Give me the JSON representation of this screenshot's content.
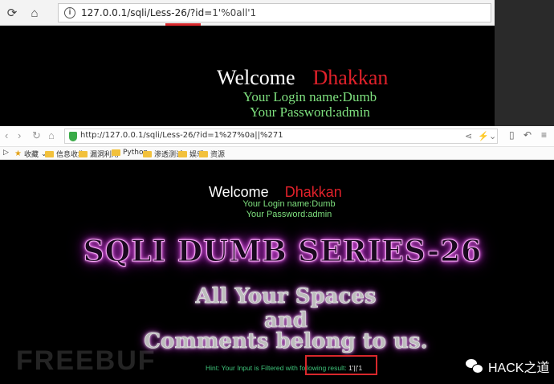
{
  "top_browser": {
    "url_prefix": "127.0.0.1/sqli/Less-26/?id=",
    "url_param": "1'%0all'1",
    "back_icon": "refresh-icon",
    "home_icon": "home-icon"
  },
  "top_page": {
    "welcome": "Welcome",
    "user": "Dhakkan",
    "login_name": "Your Login name:Dumb",
    "password": "Your Password:admin"
  },
  "second_browser": {
    "url": "http://127.0.0.1/sqli/Less-26/?id=1%27%0a||%271",
    "bookmarks": [
      "收藏",
      "信息收集",
      "漏洞利用",
      "Python",
      "渗透测试",
      "娱乐",
      "资源"
    ]
  },
  "second_page": {
    "welcome": "Welcome",
    "user": "Dhakkan",
    "login_name": "Your Login name:Dumb",
    "password": "Your Password:admin",
    "series_title": "SQLI DUMB SERIES-26",
    "line1": "All Your Spaces",
    "line2": "and",
    "line3": "Comments belong to us.",
    "hint_prefix": "Hint: Your Input is Filtered with following result:",
    "hint_result": "1'||'1"
  },
  "watermark": "FREEBUF",
  "brand": "HACK之道",
  "colors": {
    "accent_red": "#e0212a",
    "login_green": "#7ee07e",
    "hint_green": "#3ec47a",
    "glow_purple": "#c13fc9"
  }
}
